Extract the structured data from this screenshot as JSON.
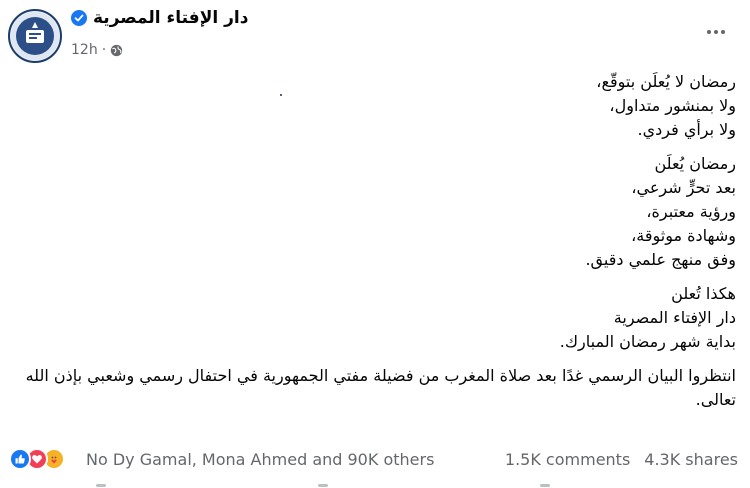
{
  "header": {
    "page_name": "دار الإفتاء المصرية",
    "time": "12h",
    "dot": "·"
  },
  "post": {
    "paragraphs": [
      [
        "رمضان لا يُعلَن بتوقّع،",
        "ولا بمنشور متداول،",
        "ولا برأي فردي."
      ],
      [
        "رمضان يُعلَن",
        "بعد تحرٍّ شرعي،",
        "ورؤية معتبرة،",
        "وشهادة موثوقة،",
        "وفق منهج علمي دقيق."
      ],
      [
        "هكذا تُعلن",
        "دار الإفتاء المصرية",
        "بداية شهر رمضان المبارك."
      ],
      [
        "انتظروا البيان الرسمي غدًا بعد صلاة المغرب من فضيلة مفتي الجمهورية في احتفال رسمي وشعبي بإذن الله تعالى."
      ]
    ]
  },
  "footer": {
    "reaction_names": "No Dy Gamal, Mona Ahmed and 90K others",
    "comments": "1.5K comments",
    "shares": "4.3K shares",
    "reaction_icons": [
      "like-icon",
      "love-icon",
      "care-icon"
    ]
  },
  "colors": {
    "verified": "#1877f2",
    "secondary_text": "#65676b",
    "avatar_border": "#1a3d6b"
  }
}
